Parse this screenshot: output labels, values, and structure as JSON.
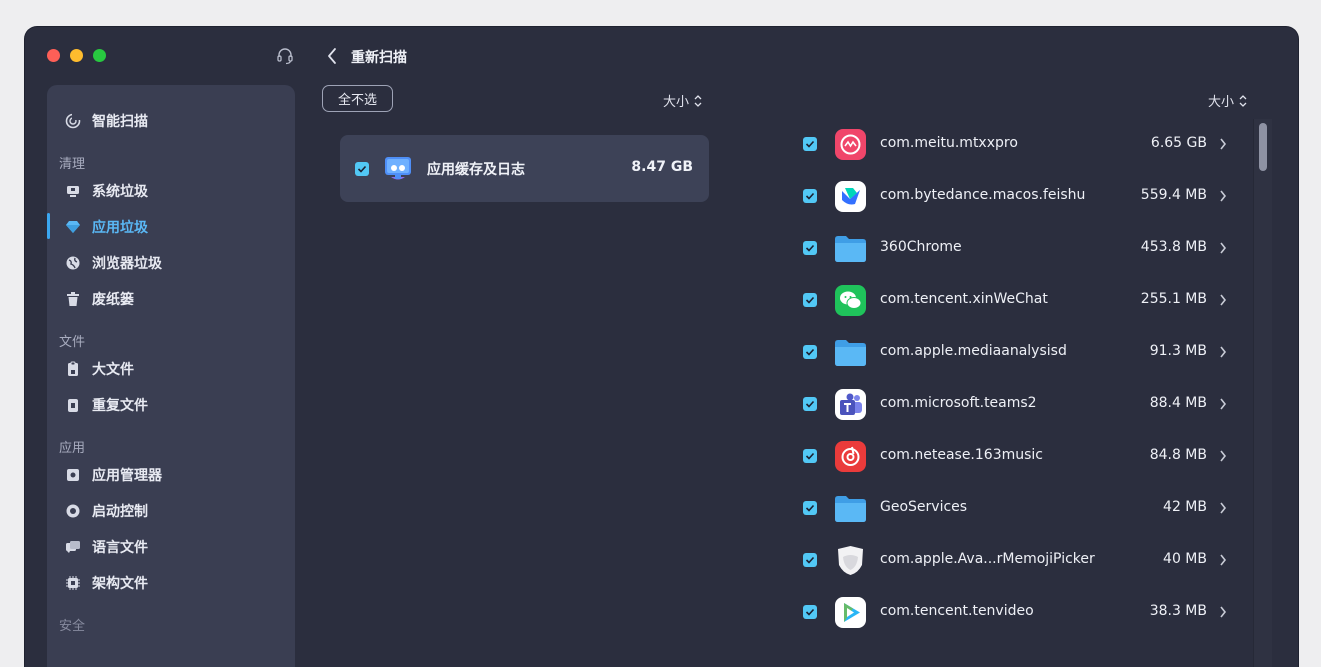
{
  "window": {
    "controls": [
      "close",
      "minimize",
      "zoom"
    ],
    "support_icon": "headset-icon"
  },
  "sidebar": {
    "top_item": {
      "label": "智能扫描",
      "icon": "smart-scan-icon"
    },
    "sections": [
      {
        "label": "清理",
        "items": [
          {
            "label": "系统垃圾",
            "icon": "system-junk-icon",
            "active": false
          },
          {
            "label": "应用垃圾",
            "icon": "app-junk-icon",
            "active": true
          },
          {
            "label": "浏览器垃圾",
            "icon": "browser-icon",
            "active": false
          },
          {
            "label": "废纸篓",
            "icon": "trash-icon",
            "active": false
          }
        ]
      },
      {
        "label": "文件",
        "items": [
          {
            "label": "大文件",
            "icon": "large-file-icon",
            "active": false
          },
          {
            "label": "重复文件",
            "icon": "duplicate-file-icon",
            "active": false
          }
        ]
      },
      {
        "label": "应用",
        "items": [
          {
            "label": "应用管理器",
            "icon": "app-manager-icon",
            "active": false
          },
          {
            "label": "启动控制",
            "icon": "startup-icon",
            "active": false
          },
          {
            "label": "语言文件",
            "icon": "language-icon",
            "active": false
          },
          {
            "label": "架构文件",
            "icon": "architecture-icon",
            "active": false
          }
        ]
      },
      {
        "label": "安全",
        "items": []
      }
    ]
  },
  "header": {
    "back_label": "重新扫描"
  },
  "toolbar": {
    "deselect_all": "全不选",
    "sort_mid": "大小",
    "sort_right": "大小"
  },
  "category": {
    "name": "应用缓存及日志",
    "size": "8.47 GB",
    "checked": true
  },
  "items": [
    {
      "name": "com.meitu.mtxxpro",
      "size": "6.65 GB",
      "icon": "meitu-icon",
      "checked": true
    },
    {
      "name": "com.bytedance.macos.feishu",
      "size": "559.4 MB",
      "icon": "feishu-icon",
      "checked": true
    },
    {
      "name": "360Chrome",
      "size": "453.8 MB",
      "icon": "folder-icon",
      "checked": true
    },
    {
      "name": "com.tencent.xinWeChat",
      "size": "255.1 MB",
      "icon": "wechat-icon",
      "checked": true
    },
    {
      "name": "com.apple.mediaanalysisd",
      "size": "91.3 MB",
      "icon": "folder-icon",
      "checked": true
    },
    {
      "name": "com.microsoft.teams2",
      "size": "88.4 MB",
      "icon": "teams-icon",
      "checked": true
    },
    {
      "name": "com.netease.163music",
      "size": "84.8 MB",
      "icon": "netease-music-icon",
      "checked": true
    },
    {
      "name": "GeoServices",
      "size": "42 MB",
      "icon": "folder-icon",
      "checked": true
    },
    {
      "name": "com.apple.Ava...rMemojiPicker",
      "size": "40 MB",
      "icon": "memoji-icon",
      "checked": true
    },
    {
      "name": "com.tencent.tenvideo",
      "size": "38.3 MB",
      "icon": "tencent-video-icon",
      "checked": true
    }
  ],
  "colors": {
    "window_bg": "#2b2e3e",
    "sidebar_bg": "#3a3e52",
    "accent": "#3ba7f0",
    "checkbox": "#52c8f5"
  }
}
